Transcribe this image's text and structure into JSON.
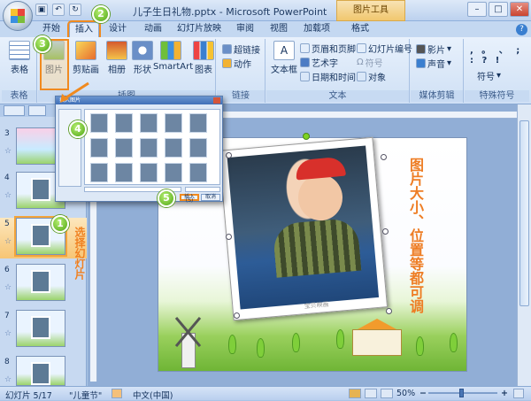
{
  "titlebar": {
    "document_title": "儿子生日礼物.pptx - Microsoft PowerPoint",
    "context_tool": "图片工具"
  },
  "tabs": [
    "开始",
    "插入",
    "设计",
    "动画",
    "幻灯片放映",
    "审阅",
    "视图",
    "加载项",
    "格式"
  ],
  "ribbon": {
    "groups": [
      "表格",
      "插图",
      "链接",
      "文本",
      "媒体剪辑",
      "特殊符号"
    ],
    "table_btn": "表格",
    "illus_btns": [
      "图片",
      "剪贴画",
      "相册",
      "形状",
      "SmartArt",
      "图表"
    ],
    "link_btns": [
      "超链接",
      "动作"
    ],
    "text_big": "文本框",
    "text_small": [
      "页眉和页脚",
      "艺术字",
      "日期和时间",
      "幻灯片编号",
      "符号",
      "对象"
    ],
    "media_btns": [
      "影片",
      "声音"
    ],
    "symbol_btn": "符号",
    "symbol_glyphs": ", 。 、 ; : ? !"
  },
  "badges": [
    "1",
    "2",
    "3",
    "4",
    "5"
  ],
  "thumbnails": [
    {
      "num": "3",
      "star": "☆"
    },
    {
      "num": "4",
      "star": "☆"
    },
    {
      "num": "5",
      "star": "☆",
      "selected": true
    },
    {
      "num": "6",
      "star": "☆"
    },
    {
      "num": "7",
      "star": "☆"
    },
    {
      "num": "8",
      "star": "☆"
    }
  ],
  "annotations": {
    "select_slide": "选择幻灯片",
    "slide_note": "图片大小、位置等都可调"
  },
  "photo": {
    "watermark": "宝贝映画"
  },
  "dialog": {
    "title": "插入图片",
    "insert": "插入(S)",
    "cancel": "取消"
  },
  "statusbar": {
    "slide_info": "幻灯片 5/17",
    "theme": "\"儿童节\"",
    "language": "中文(中国)",
    "zoom": "50%"
  },
  "colors": {
    "accent": "#f08a1f",
    "title": "#ee7d24",
    "ribbon": "#dfeafa"
  }
}
